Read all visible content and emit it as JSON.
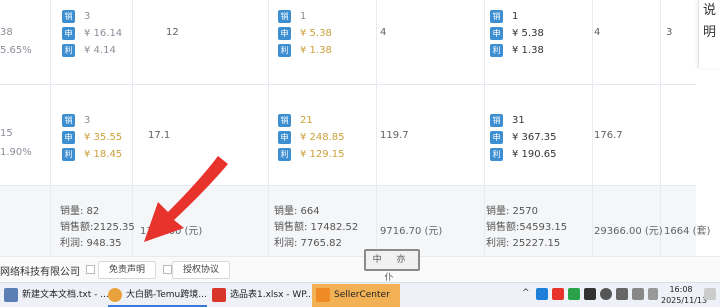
{
  "sidebar": {
    "chars": [
      "说",
      "明"
    ]
  },
  "rows": [
    {
      "left_partial": [
        "38",
        "5.65%"
      ],
      "groups": [
        {
          "sales": "3",
          "apply": "¥ 16.14",
          "profit": "¥ 4.14",
          "after": "12"
        },
        {
          "sales": "1",
          "apply": "¥ 5.38",
          "profit": "¥ 1.38",
          "after": "4"
        },
        {
          "sales": "1",
          "apply": "¥ 5.38",
          "profit": "¥ 1.38",
          "after": "4"
        }
      ],
      "last_col": "3"
    },
    {
      "left_partial": [
        "15",
        "1.90%"
      ],
      "groups": [
        {
          "sales": "3",
          "apply": "¥ 35.55",
          "profit": "¥ 18.45",
          "after": "17.1"
        },
        {
          "sales": "21",
          "apply": "¥ 248.85",
          "profit": "¥ 129.15",
          "after": "119.7"
        },
        {
          "sales": "31",
          "apply": "¥ 367.35",
          "profit": "¥ 190.65",
          "after": "176.7"
        }
      ],
      "last_col": ""
    }
  ],
  "tags": {
    "sales": "销",
    "apply": "申",
    "profit": "利"
  },
  "summary": [
    {
      "sales": "销量: 82",
      "revenue": "销售额:2125.35",
      "profit": "利润: 948.35",
      "after": "1177.00 (元)"
    },
    {
      "sales": "销量: 664",
      "revenue": "销售额: 17482.52",
      "profit": "利润: 7765.82",
      "after": "9716.70 (元)"
    },
    {
      "sales": "销量: 2570",
      "revenue": "销售额:54593.15",
      "profit": "利润: 25227.15",
      "after": "29366.00 (元)"
    }
  ],
  "summary_last": "1664 (套)",
  "stamp": "中 亦 仆",
  "footer": {
    "company": "网络科技有限公司",
    "disclaimer": "免责声明",
    "license": "授权协议"
  },
  "taskbar": {
    "items": [
      {
        "label": "新建文本文档.txt - ...",
        "icon_color": "#5b7fb5"
      },
      {
        "label": "大白鹅-Temu跨境...",
        "icon_color": "#e9a23b"
      },
      {
        "label": "选品表1.xlsx - WP...",
        "icon_color": "#d9362b"
      },
      {
        "label": "SellerCenter",
        "icon_color": "#f08a24"
      }
    ],
    "time": "16:08",
    "date": "2025/11/13"
  },
  "colors": {
    "tag": "#3d8fd1",
    "gold": "#c9a13a",
    "arrow": "#e8322c"
  }
}
